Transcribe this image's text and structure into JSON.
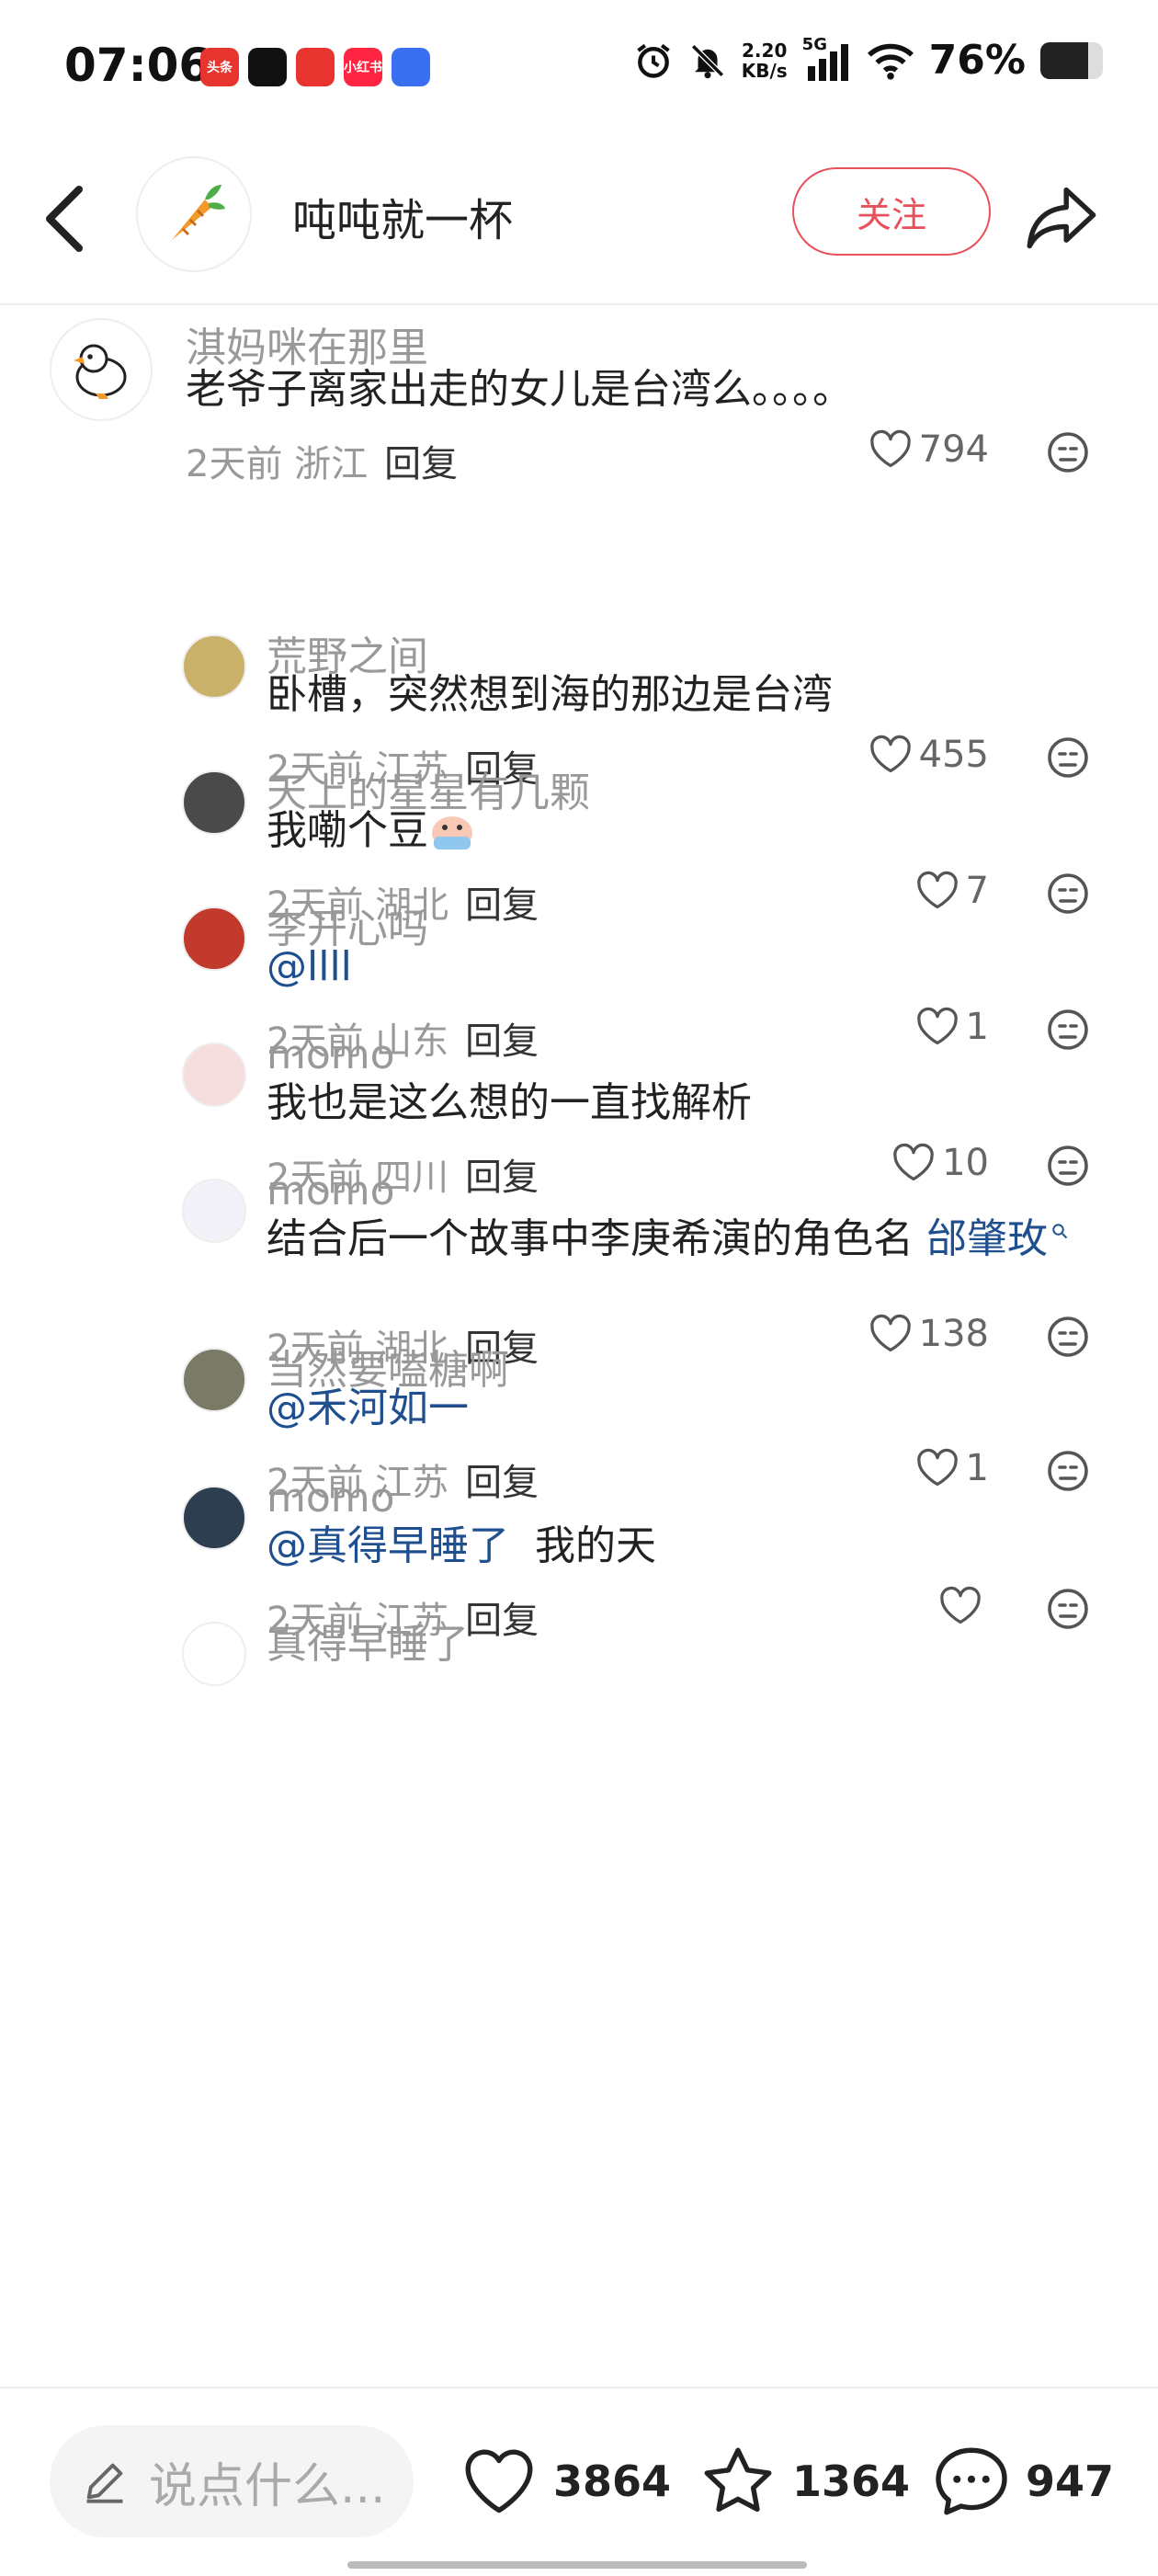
{
  "status_bar": {
    "time": "07:06",
    "apps": [
      {
        "name": "toutiao-icon",
        "label": "头条",
        "color": "#e8342f"
      },
      {
        "name": "douyin-icon",
        "label": "",
        "color": "#111111"
      },
      {
        "name": "clown-app-icon",
        "label": "",
        "color": "#e8342f"
      },
      {
        "name": "xiaohongshu-icon",
        "label": "小红书",
        "color": "#ff2442"
      },
      {
        "name": "baidu-icon",
        "label": "",
        "color": "#3a6ff2"
      }
    ],
    "net_speed_value": "2.20",
    "net_speed_unit": "KB/s",
    "signal_label": "5G",
    "battery_pct_label": "76%",
    "battery_level": 0.76
  },
  "header": {
    "author_name": "吨吨就一杯",
    "follow_label": "关注"
  },
  "comments": [
    {
      "user": "淇妈咪在那里",
      "parts": [
        {
          "text": "老爷子离家出走的女儿是台湾么。。。。",
          "mention": false
        }
      ],
      "time": "2天前",
      "location": "浙江",
      "reply": "回复",
      "likes": "794",
      "level": 0,
      "avatar_color": "#ffffff"
    },
    {
      "user": "荒野之间",
      "parts": [
        {
          "text": "卧槽，突然想到海的那边是台湾",
          "mention": false
        }
      ],
      "time": "2天前",
      "location": "江苏",
      "reply": "回复",
      "likes": "455",
      "level": 1,
      "avatar_color": "#c9b16a"
    },
    {
      "user": "天上的星星有几颗",
      "parts": [
        {
          "text": "我嘞个豆",
          "mention": false
        }
      ],
      "time": "2天前",
      "location": "湖北",
      "reply": "回复",
      "likes": "7",
      "level": 1,
      "avatar_color": "#4a4a4a"
    },
    {
      "user": "李开心吗",
      "parts": [
        {
          "text": "@llll",
          "mention": true
        }
      ],
      "time": "2天前",
      "location": "山东",
      "reply": "回复",
      "likes": "1",
      "level": 1,
      "avatar_color": "#c23a2c"
    },
    {
      "user": "momo",
      "parts": [
        {
          "text": "我也是这么想的一直找解析",
          "mention": false
        }
      ],
      "time": "2天前",
      "location": "四川",
      "reply": "回复",
      "likes": "10",
      "level": 1,
      "avatar_color": "#f7dede"
    },
    {
      "user": "momo",
      "parts": [
        {
          "text": "结合后一个故事中李庚希演的角色名 ",
          "mention": false
        },
        {
          "text": "邰肇玫",
          "mention": true
        }
      ],
      "time": "2天前",
      "location": "湖北",
      "reply": "回复",
      "likes": "138",
      "level": 1,
      "avatar_color": "#f2f2f8"
    },
    {
      "user": "当然要嗑糖啊",
      "parts": [
        {
          "text": "@禾河如一",
          "mention": true
        }
      ],
      "time": "2天前",
      "location": "江苏",
      "reply": "回复",
      "likes": "1",
      "level": 1,
      "avatar_color": "#7a7a66"
    },
    {
      "user": "momo",
      "parts": [
        {
          "text": "@真得早睡了",
          "mention": true
        },
        {
          "text": "  我的天",
          "mention": false
        }
      ],
      "time": "2天前",
      "location": "江苏",
      "reply": "回复",
      "likes": "",
      "level": 1,
      "avatar_color": "#2c3e50"
    },
    {
      "user": "真得早睡了",
      "parts": [],
      "time": "",
      "location": "",
      "reply": "",
      "likes": "",
      "level": 1,
      "avatar_color": "#ffffff"
    }
  ],
  "bottom_bar": {
    "input_placeholder": "说点什么...",
    "likes_count": "3864",
    "favorites_count": "1364",
    "comments_count": "947"
  }
}
